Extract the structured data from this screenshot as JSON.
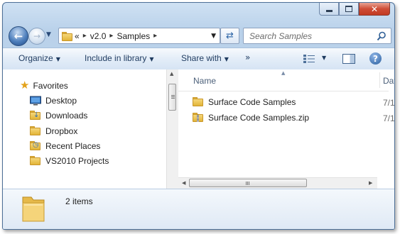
{
  "address": {
    "overflow": "«",
    "crumbs": [
      "v2.0",
      "Samples"
    ]
  },
  "search": {
    "placeholder": "Search Samples"
  },
  "toolbar": {
    "organize": "Organize",
    "include_in_library": "Include in library",
    "share_with": "Share with",
    "more": "»"
  },
  "nav_pane": {
    "favorites_label": "Favorites",
    "items": [
      {
        "label": "Desktop",
        "icon": "desktop-icon"
      },
      {
        "label": "Downloads",
        "icon": "downloads-folder-icon"
      },
      {
        "label": "Dropbox",
        "icon": "folder-icon"
      },
      {
        "label": "Recent Places",
        "icon": "recent-places-icon"
      },
      {
        "label": "VS2010 Projects",
        "icon": "folder-icon"
      }
    ]
  },
  "file_list": {
    "columns": {
      "name": "Name",
      "date": "Dat"
    },
    "files": [
      {
        "name": "Surface Code Samples",
        "date": "7/1",
        "type": "folder"
      },
      {
        "name": "Surface Code Samples.zip",
        "date": "7/1",
        "type": "zip-folder"
      }
    ]
  },
  "details": {
    "count": "2 items"
  },
  "colors": {
    "chrome": "#c4d8ee",
    "toolbar_text": "#1e3a5f",
    "folder": "#e2b437",
    "close_button": "#c23a23"
  }
}
